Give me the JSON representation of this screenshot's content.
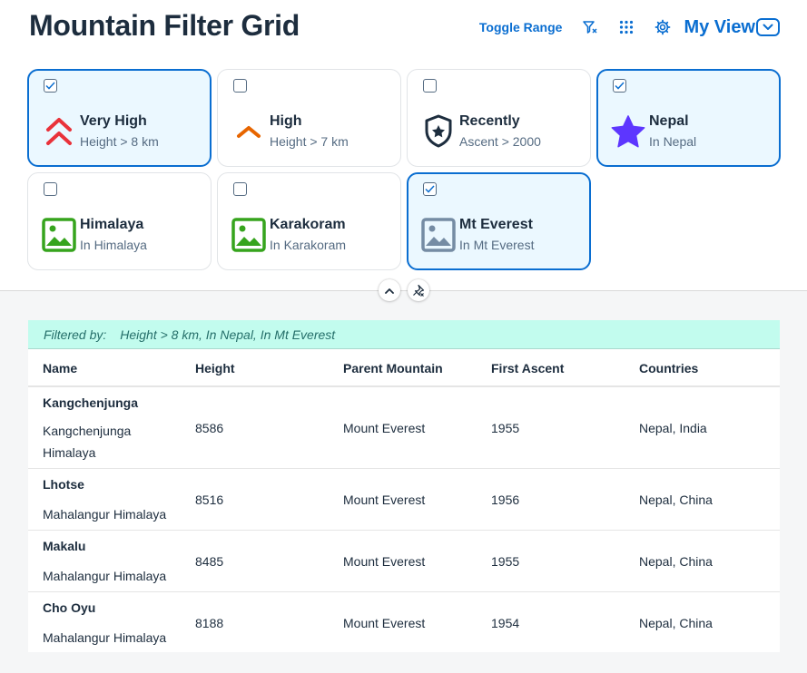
{
  "page": {
    "title": "Mountain Filter Grid"
  },
  "toolbar": {
    "toggle_range_label": "Toggle Range",
    "my_view_label": "My View"
  },
  "tiles": [
    {
      "title": "Very High",
      "subtitle": "Height > 8 km",
      "selected": true,
      "icon": "double-chevron-up-icon"
    },
    {
      "title": "High",
      "subtitle": "Height > 7 km",
      "selected": false,
      "icon": "chevron-up-icon"
    },
    {
      "title": "Recently",
      "subtitle": "Ascent > 2000",
      "selected": false,
      "icon": "shield-star-icon"
    },
    {
      "title": "Nepal",
      "subtitle": "In Nepal",
      "selected": true,
      "icon": "star-icon"
    },
    {
      "title": "Himalaya",
      "subtitle": "In Himalaya",
      "selected": false,
      "icon": "image-icon"
    },
    {
      "title": "Karakoram",
      "subtitle": "In Karakoram",
      "selected": false,
      "icon": "image-icon"
    },
    {
      "title": "Mt Everest",
      "subtitle": "In Mt Everest",
      "selected": true,
      "icon": "image-icon"
    }
  ],
  "filter_bar": {
    "label": "Filtered by:",
    "value": "Height > 8 km, In Nepal, In Mt Everest"
  },
  "table": {
    "columns": [
      "Name",
      "Height",
      "Parent Mountain",
      "First Ascent",
      "Countries"
    ],
    "rows": [
      {
        "name": "Kangchenjunga",
        "range": "Kangchenjunga Himalaya",
        "height": "8586",
        "parent": "Mount Everest",
        "first_ascent": "1955",
        "countries": "Nepal, India"
      },
      {
        "name": "Lhotse",
        "range": "Mahalangur Himalaya",
        "height": "8516",
        "parent": "Mount Everest",
        "first_ascent": "1956",
        "countries": "Nepal, China"
      },
      {
        "name": "Makalu",
        "range": "Mahalangur Himalaya",
        "height": "8485",
        "parent": "Mount Everest",
        "first_ascent": "1955",
        "countries": "Nepal, China"
      },
      {
        "name": "Cho Oyu",
        "range": "Mahalangur Himalaya",
        "height": "8188",
        "parent": "Mount Everest",
        "first_ascent": "1954",
        "countries": "Nepal, China"
      }
    ]
  },
  "colors": {
    "accent": "#0a6ed1",
    "selected_tile_bg": "#ebf8ff",
    "filter_bar_bg": "#c2fcee",
    "very_high_icon": "#e9323a",
    "high_icon": "#e76500",
    "star_icon": "#5d36ff",
    "image_icon_green": "#36a41d",
    "image_icon_grey": "#758ca4"
  }
}
